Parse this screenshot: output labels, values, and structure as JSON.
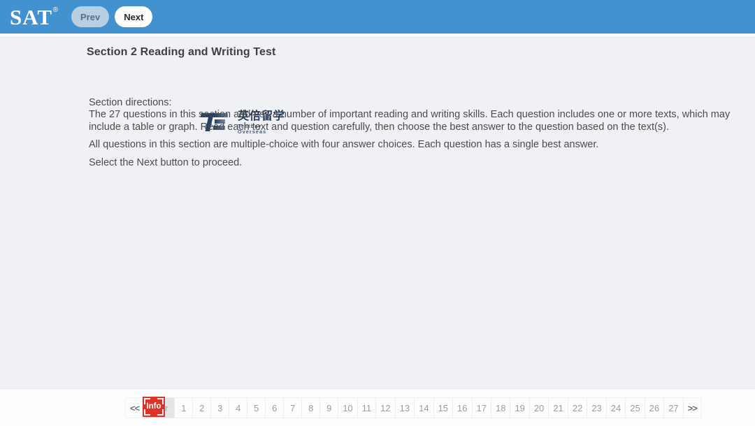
{
  "header": {
    "brand": "SAT",
    "brand_trademark": "®",
    "prev_label": "Prev",
    "next_label": "Next",
    "background_color": "#4292cf"
  },
  "content": {
    "section_title": "Section 2 Reading and Writing Test",
    "directions_label": "Section directions:",
    "paragraph_1": "The 27 questions in this section address a number of important reading and writing skills. Each question includes one or more texts, which may include a table or graph. Read each text and question carefully, then choose the best answer to the question based on the text(s).",
    "paragraph_2": "All questions in this section are multiple-choice with four answer choices. Each question has a single best answer.",
    "paragraph_3": "Select the Next button to proceed."
  },
  "partner_logo": {
    "mark_text": "TB",
    "chinese_name": "英倍留学",
    "english_name": "Testbay  Overseas",
    "color": "#253c59"
  },
  "footer": {
    "pager": {
      "prev_arrow": "<<",
      "next_arrow": ">>",
      "instructions_label": "Instr",
      "pages": [
        "1",
        "2",
        "3",
        "4",
        "5",
        "6",
        "7",
        "8",
        "9",
        "10",
        "11",
        "12",
        "13",
        "14",
        "15",
        "16",
        "17",
        "18",
        "19",
        "20",
        "21",
        "22",
        "23",
        "24",
        "25",
        "26",
        "27"
      ]
    }
  },
  "annotation": {
    "info_badge_label": "Info",
    "info_badge_color": "#e03127"
  }
}
